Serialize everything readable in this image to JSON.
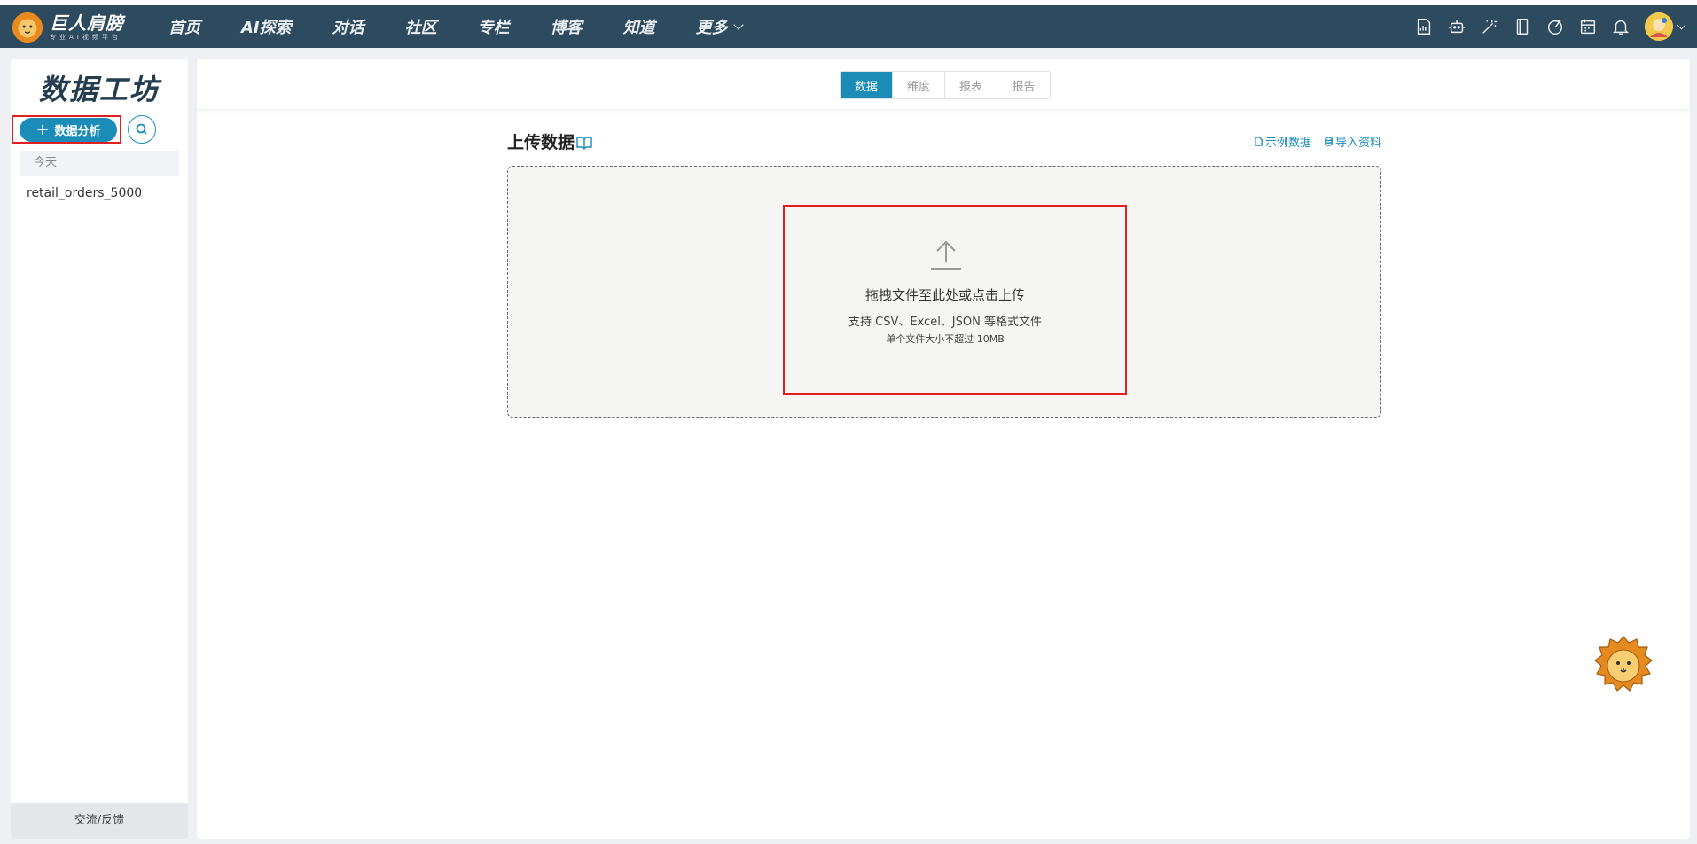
{
  "brand": {
    "title": "巨人肩膀",
    "subtitle": "专业AI视频平台"
  },
  "nav": {
    "items": [
      "首页",
      "AI探索",
      "对话",
      "社区",
      "专栏",
      "博客",
      "知道",
      "更多"
    ]
  },
  "nav_icons": [
    "report-icon",
    "robot-icon",
    "magic-wand-icon",
    "notebook-icon",
    "rocket-icon",
    "calendar-icon",
    "bell-icon"
  ],
  "sidebar": {
    "title": "数据工坊",
    "new_button": "数据分析",
    "group_label": "今天",
    "items": [
      "retail_orders_5000"
    ],
    "footer": "交流/反馈"
  },
  "tabs": [
    "数据",
    "维度",
    "报表",
    "报告"
  ],
  "active_tab": "数据",
  "upload": {
    "title": "上传数据",
    "sample_link": "示例数据",
    "import_link": "导入资料",
    "drop_main": "拖拽文件至此处或点击上传",
    "drop_formats": "支持 CSV、Excel、JSON 等格式文件",
    "drop_limit": "单个文件大小不超过 10MB"
  },
  "colors": {
    "navbar": "#2e4a5e",
    "accent": "#1b8bb8",
    "highlight_frame": "#e02020"
  }
}
